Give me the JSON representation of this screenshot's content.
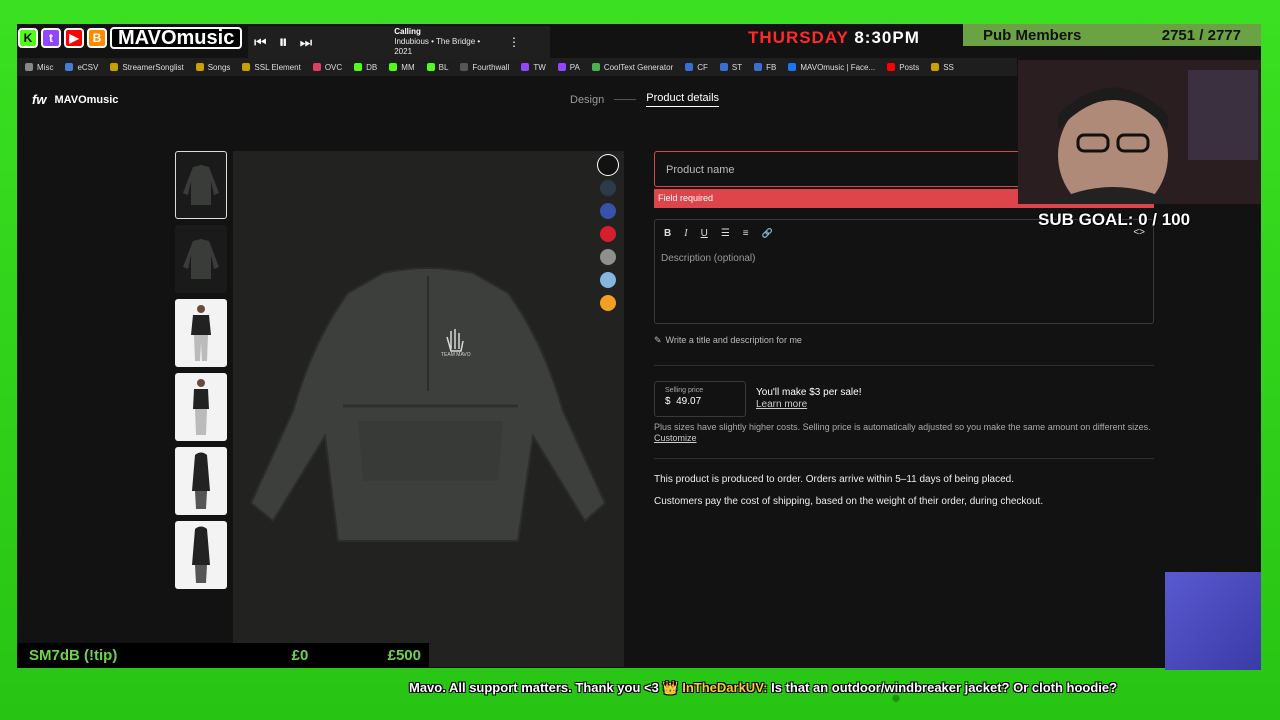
{
  "stream": {
    "brand": "MAVOmusic",
    "badges": [
      "K",
      "t",
      "▶",
      "B"
    ],
    "player": {
      "track_title": "Calling",
      "track_sub": "Indubious • The Bridge • 2021"
    },
    "day": "THURSDAY",
    "time": "8:30PM",
    "pub_label": "Pub Members",
    "pub_count": "2751 / 2777",
    "sub_goal": "SUB GOAL: 0 / 100",
    "tip_label": "SM7dB (!tip)",
    "tip_min": "£0",
    "tip_max": "£500",
    "ticker_text": "Mavo. All support matters. Thank you <3 👑 ",
    "ticker_user": "InTheDarkUV:",
    "ticker_msg": " Is that an outdoor/windbreaker jacket? Or cloth hoodie?"
  },
  "bookmarks": [
    "Misc",
    "eCSV",
    "StreamerSonglist",
    "Songs",
    "SSL Element",
    "OVC",
    "DB",
    "MM",
    "BL",
    "Fourthwall",
    "TW",
    "PA",
    "CoolText Generator",
    "CF",
    "ST",
    "FB",
    "MAVOmusic | Face...",
    "Posts",
    "SS"
  ],
  "app": {
    "logo_mark": "fw",
    "shop_name": "MAVOmusic",
    "steps": {
      "design": "Design",
      "details": "Product details"
    }
  },
  "swatch_colors": [
    "#121212",
    "#2d3a4a",
    "#3553a8",
    "#d81e2c",
    "#8f8f8f",
    "#86b6e0",
    "#f2a022"
  ],
  "form": {
    "product_name_placeholder": "Product name",
    "error": "Field required",
    "toolbar": {
      "bold": "B",
      "italic": "I",
      "underline": "U",
      "bullets": "☰",
      "numbered": "≡",
      "link": "🔗",
      "code": "<>"
    },
    "description_placeholder": "Description (optional)",
    "ai_prompt": "Write a title and description for me",
    "price_label": "Selling price",
    "currency": "$",
    "price_value": "49.07",
    "make_text": "You'll make $3 per sale!",
    "learn_more": "Learn more",
    "plus_text": "Plus sizes have slightly higher costs. Selling price is automatically adjusted so you make the same amount on different sizes.",
    "customize": "Customize",
    "info1": "This product is produced to order. Orders arrive within 5–11 days of being placed.",
    "info2": "Customers pay the cost of shipping, based on the weight of their order, during checkout."
  }
}
